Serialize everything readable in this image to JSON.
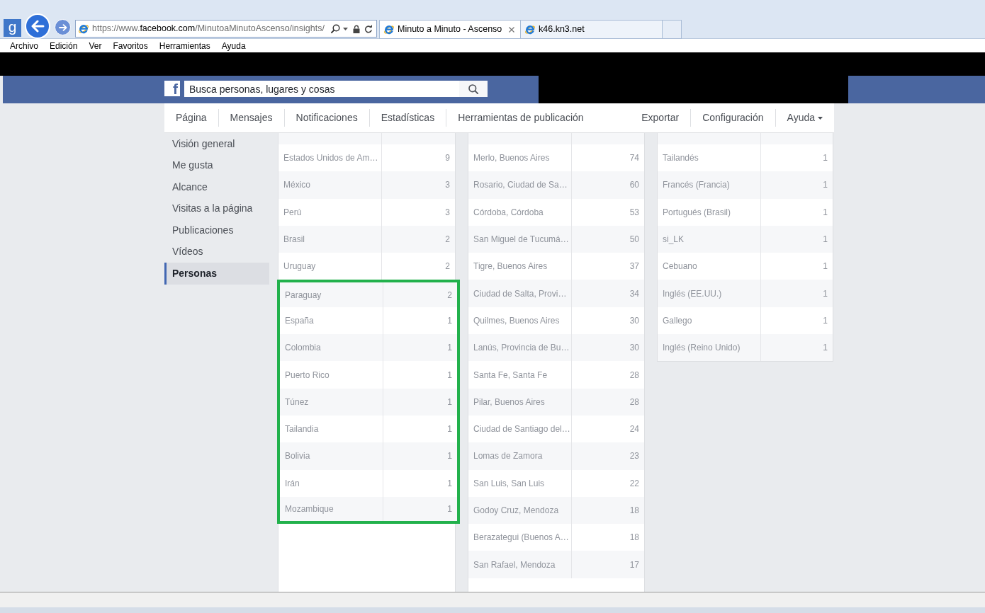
{
  "browser": {
    "google_button": {
      "label": "g"
    },
    "address": {
      "prefix": "https://www.",
      "domain": "facebook.com",
      "path": "/MinutoaMinutoAscenso/insights/"
    },
    "tabs": [
      {
        "label": "Minuto a Minuto - Ascenso",
        "selected": true
      },
      {
        "label": "k46.kn3.net",
        "selected": false
      }
    ],
    "menu": [
      "Archivo",
      "Edición",
      "Ver",
      "Favoritos",
      "Herramientas",
      "Ayuda"
    ]
  },
  "header": {
    "logo": "f",
    "search": {
      "placeholder": "Busca personas, lugares y cosas"
    }
  },
  "nav": {
    "left": [
      {
        "label": "Página"
      },
      {
        "label": "Mensajes"
      },
      {
        "label": "Notificaciones"
      },
      {
        "label": "Estadísticas"
      },
      {
        "label": "Herramientas de publicación"
      }
    ],
    "right": [
      {
        "label": "Exportar",
        "dropdown": false
      },
      {
        "label": "Configuración",
        "dropdown": false
      },
      {
        "label": "Ayuda",
        "dropdown": true
      }
    ]
  },
  "sidebar": {
    "items": [
      {
        "label": "Visión general",
        "selected": false
      },
      {
        "label": "Me gusta",
        "selected": false
      },
      {
        "label": "Alcance",
        "selected": false
      },
      {
        "label": "Visitas a la página",
        "selected": false
      },
      {
        "label": "Publicaciones",
        "selected": false
      },
      {
        "label": "Vídeos",
        "selected": false
      },
      {
        "label": "Personas",
        "selected": true
      }
    ]
  },
  "tables": [
    {
      "rows": [
        {
          "label": "Estados Unidos de Am…",
          "count": "9",
          "highlighted": false
        },
        {
          "label": "México",
          "count": "3",
          "highlighted": false
        },
        {
          "label": "Perú",
          "count": "3",
          "highlighted": false
        },
        {
          "label": "Brasil",
          "count": "2",
          "highlighted": false
        },
        {
          "label": "Uruguay",
          "count": "2",
          "highlighted": false
        },
        {
          "label": "Paraguay",
          "count": "2",
          "highlighted": true
        },
        {
          "label": "España",
          "count": "1",
          "highlighted": true
        },
        {
          "label": "Colombia",
          "count": "1",
          "highlighted": true
        },
        {
          "label": "Puerto Rico",
          "count": "1",
          "highlighted": true
        },
        {
          "label": "Túnez",
          "count": "1",
          "highlighted": true
        },
        {
          "label": "Tailandia",
          "count": "1",
          "highlighted": true
        },
        {
          "label": "Bolivia",
          "count": "1",
          "highlighted": true
        },
        {
          "label": "Irán",
          "count": "1",
          "highlighted": true
        },
        {
          "label": "Mozambique",
          "count": "1",
          "highlighted": true
        }
      ]
    },
    {
      "rows": [
        {
          "label": "Merlo, Buenos Aires",
          "count": "74"
        },
        {
          "label": "Rosario, Ciudad de Sa…",
          "count": "60"
        },
        {
          "label": "Córdoba, Córdoba",
          "count": "53"
        },
        {
          "label": "San Miguel de Tucumá…",
          "count": "50"
        },
        {
          "label": "Tigre, Buenos Aires",
          "count": "37"
        },
        {
          "label": "Ciudad de Salta, Provi…",
          "count": "34"
        },
        {
          "label": "Quilmes, Buenos Aires",
          "count": "30"
        },
        {
          "label": "Lanús, Provincia de Bu…",
          "count": "30"
        },
        {
          "label": "Santa Fe, Santa Fe",
          "count": "28"
        },
        {
          "label": "Pilar, Buenos Aires",
          "count": "28"
        },
        {
          "label": "Ciudad de Santiago del…",
          "count": "24"
        },
        {
          "label": "Lomas de Zamora",
          "count": "23"
        },
        {
          "label": "San Luis, San Luis",
          "count": "22"
        },
        {
          "label": "Godoy Cruz, Mendoza",
          "count": "18"
        },
        {
          "label": "Berazategui (Buenos A…",
          "count": "18"
        },
        {
          "label": "San Rafael, Mendoza",
          "count": "17"
        }
      ]
    },
    {
      "rows": [
        {
          "label": "Tailandés",
          "count": "1"
        },
        {
          "label": "Francés (Francia)",
          "count": "1"
        },
        {
          "label": "Portugués (Brasil)",
          "count": "1"
        },
        {
          "label": "si_LK",
          "count": "1"
        },
        {
          "label": "Cebuano",
          "count": "1"
        },
        {
          "label": "Inglés (EE.UU.)",
          "count": "1"
        },
        {
          "label": "Gallego",
          "count": "1"
        },
        {
          "label": "Inglés (Reino Unido)",
          "count": "1"
        }
      ]
    }
  ]
}
